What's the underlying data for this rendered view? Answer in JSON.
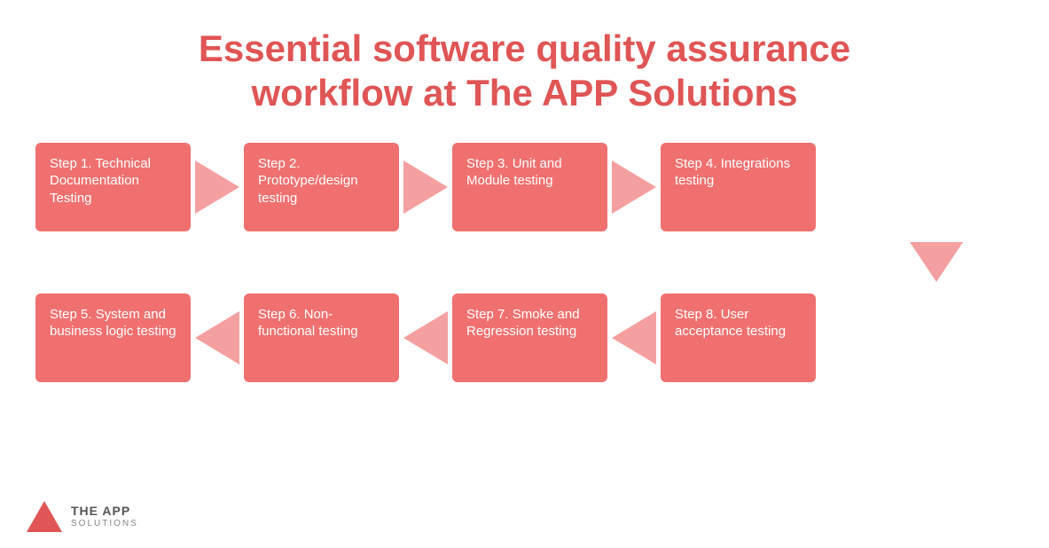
{
  "title": {
    "line1": "Essential software quality assurance",
    "line2": "workflow at The APP Solutions"
  },
  "steps": {
    "step1": "Step 1. Technical Documentation Testing",
    "step2": "Step 2. Prototype/design testing",
    "step3": "Step 3. Unit and Module testing",
    "step4": "Step 4. Integrations testing",
    "step5": "Step 5. System and business logic testing",
    "step6": "Step 6. Non-functional testing",
    "step7": "Step 7. Smoke and Regression testing",
    "step8": "Step 8. User acceptance testing"
  },
  "logo": {
    "the": "THE APP",
    "solutions": "SOLUTIONS"
  },
  "colors": {
    "accent": "#e05555",
    "box": "#f07070",
    "arrow": "#f5a0a0"
  }
}
